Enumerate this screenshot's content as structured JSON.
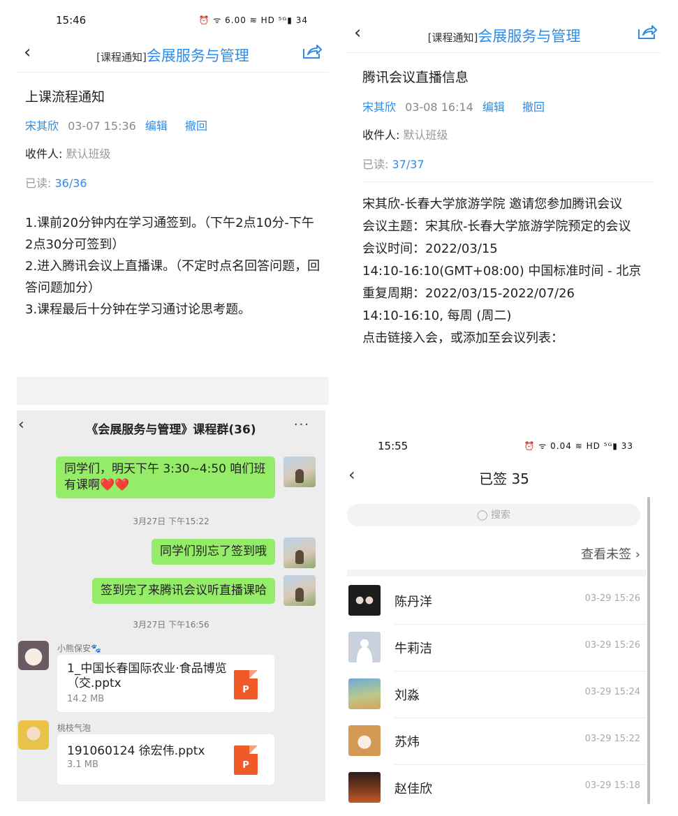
{
  "panel1": {
    "status": {
      "time": "15:46",
      "icons": "⏰ ᯤ 6.00 ≋ HD ⁵ᴳ▮ 34"
    },
    "nav": {
      "tag": "[课程通知]",
      "title": "会展服务与管理"
    },
    "notice_title": "上课流程通知",
    "author": "宋其欣",
    "datetime": "03-07 15:36",
    "edit": "编辑",
    "revoke": "撤回",
    "recipient_label": "收件人: ",
    "recipient_value": "默认班级",
    "read_label": "已读: ",
    "read_value": "36/36",
    "body": [
      "1.课前20分钟内在学习通签到。（下午2点10分-下午2点30分可签到）",
      "2.进入腾讯会议上直播课。（不定时点名回答问题，回答问题加分）",
      "3.课程最后十分钟在学习通讨论思考题。"
    ]
  },
  "panel2": {
    "nav": {
      "tag": "[课程通知]",
      "title": "会展服务与管理"
    },
    "notice_title": "腾讯会议直播信息",
    "author": "宋其欣",
    "datetime": "03-08 16:14",
    "edit": "编辑",
    "revoke": "撤回",
    "recipient_label": "收件人: ",
    "recipient_value": "默认班级",
    "read_label": "已读: ",
    "read_value": "37/37",
    "body": [
      "宋其欣-长春大学旅游学院 邀请您参加腾讯会议",
      "会议主题：宋其欣-长春大学旅游学院预定的会议",
      "会议时间：2022/03/15",
      "14:10-16:10(GMT+08:00) 中国标准时间 - 北京",
      "重复周期：2022/03/15-2022/07/26",
      "14:10-16:10, 每周 (周二)",
      "点击链接入会，或添加至会议列表："
    ]
  },
  "panel3": {
    "title": "《会展服务与管理》课程群(36)",
    "more": "···",
    "messages": {
      "m1": "同学们，明天下午 3:30~4:50 咱们班有课啊❤️❤️",
      "ts1": "3月27日 下午15:22",
      "m2": "同学们别忘了签到哦",
      "m3": "签到完了来腾讯会议听直播课哈",
      "ts2": "3月27日 下午16:56",
      "sender1": "小熊保安🐾",
      "file1_name": "1_中国长春国际农业·食品博览（交.pptx",
      "file1_size": "14.2 MB",
      "sender2": "桃枝气泡",
      "file2_name": "191060124 徐宏伟.pptx",
      "file2_size": "3.1 MB",
      "ppt_letter": "P"
    }
  },
  "panel4": {
    "status": {
      "time": "15:55",
      "icons": "⏰ ᯤ 0.04 ≋ HD ⁵ᴳ▮ 33"
    },
    "title": "已签 35",
    "search_placeholder": "◯ 搜索",
    "view_unsigned": "查看未签 ›",
    "rows": [
      {
        "name": "陈丹洋",
        "time": "03-29 15:26"
      },
      {
        "name": "牛莉洁",
        "time": "03-29 15:26"
      },
      {
        "name": "刘淼",
        "time": "03-29 15:24"
      },
      {
        "name": "苏炜",
        "time": "03-29 15:22"
      },
      {
        "name": "赵佳欣",
        "time": "03-29 15:18"
      }
    ]
  },
  "colors": {
    "accent": "#2e8ce6",
    "chat_green": "#95ec69",
    "chat_bg": "#ededed",
    "ppt_orange": "#f05a28"
  }
}
